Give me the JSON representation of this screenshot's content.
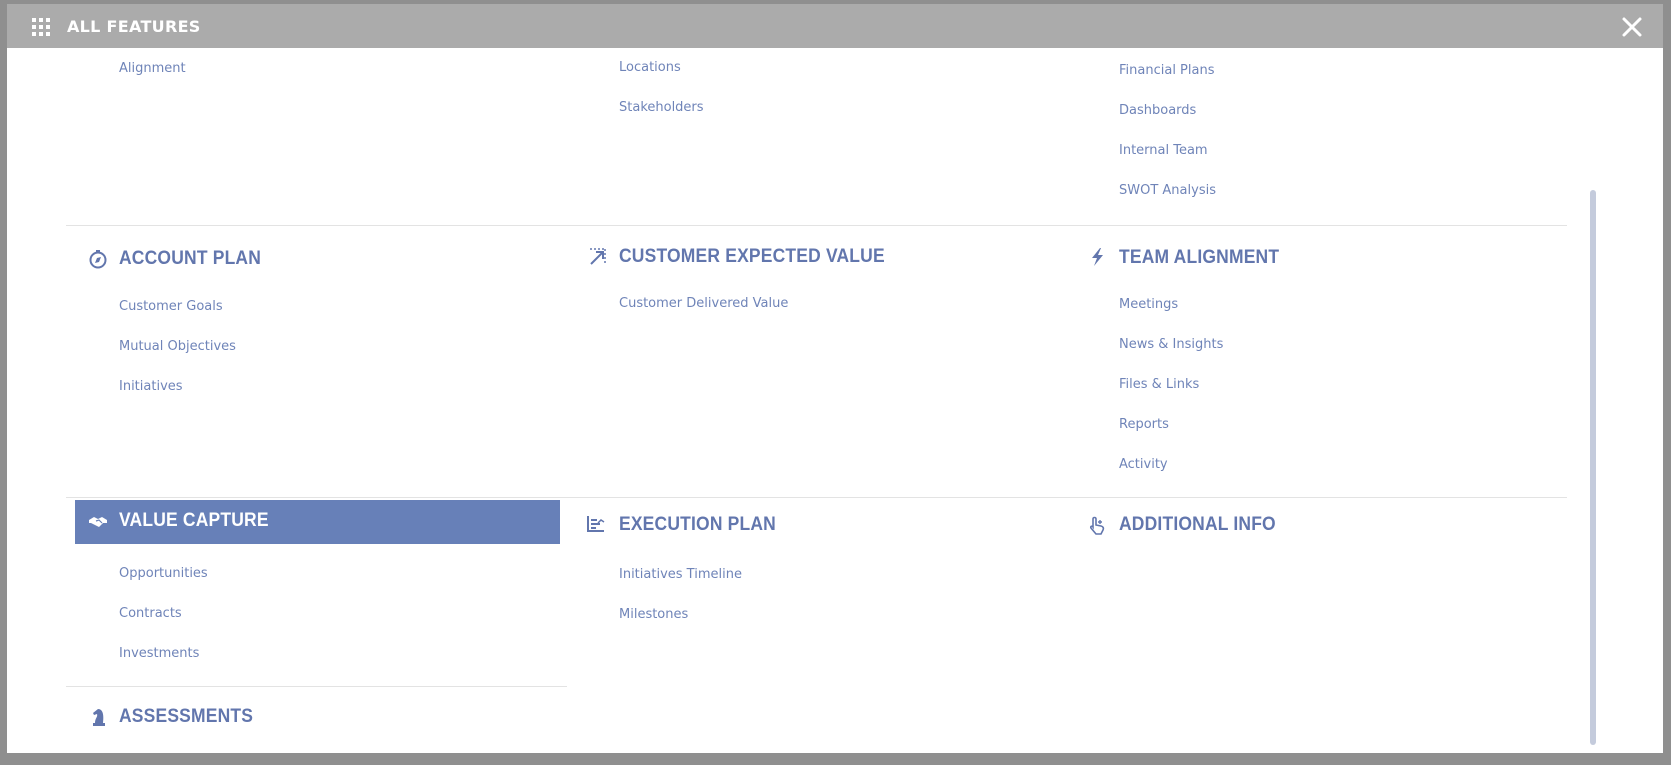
{
  "modal": {
    "title": "ALL FEATURES",
    "header_icon": "grid-icon",
    "close_icon": "close-icon"
  },
  "colors": {
    "header_bg": "#ababab",
    "accent": "#6780b8",
    "link": "#6f84b8"
  },
  "columns": {
    "col1_top": [
      "Alignment"
    ],
    "col2_top": [
      "Locations",
      "Stakeholders"
    ],
    "col3_top": [
      "Financial Plans",
      "Dashboards",
      "Internal Team",
      "SWOT Analysis"
    ]
  },
  "sections": {
    "account_plan": {
      "title": "ACCOUNT PLAN",
      "icon": "compass-icon",
      "items": [
        "Customer Goals",
        "Mutual Objectives",
        "Initiatives"
      ]
    },
    "customer_expected_value": {
      "title": "CUSTOMER EXPECTED VALUE",
      "icon": "arrow-expand-icon",
      "items": [
        "Customer Delivered Value"
      ]
    },
    "team_alignment": {
      "title": "TEAM ALIGNMENT",
      "icon": "lightning-icon",
      "items": [
        "Meetings",
        "News & Insights",
        "Files & Links",
        "Reports",
        "Activity"
      ]
    },
    "value_capture": {
      "title": "VALUE CAPTURE",
      "icon": "handshake-icon",
      "items": [
        "Opportunities",
        "Contracts",
        "Investments"
      ]
    },
    "execution_plan": {
      "title": "EXECUTION PLAN",
      "icon": "chart-list-icon",
      "items": [
        "Initiatives Timeline",
        "Milestones"
      ]
    },
    "additional_info": {
      "title": "ADDITIONAL INFO",
      "icon": "hand-pointer-icon",
      "items": []
    },
    "assessments": {
      "title": "ASSESSMENTS",
      "icon": "chess-knight-icon",
      "items": []
    }
  }
}
